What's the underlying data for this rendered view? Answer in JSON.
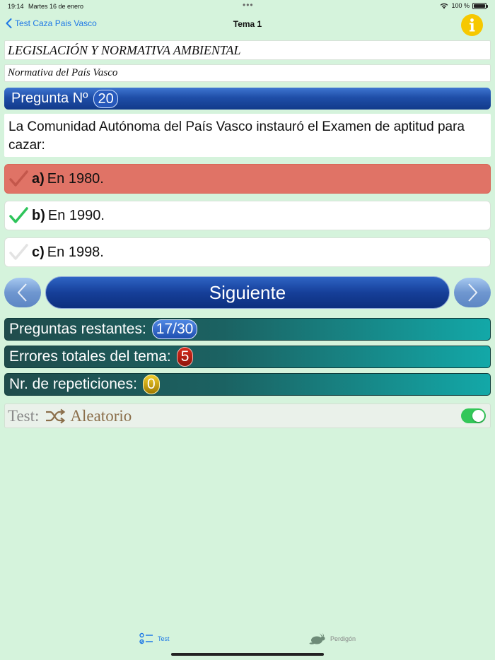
{
  "status_bar": {
    "time": "19:14",
    "date": "Martes 16 de enero",
    "battery": "100 %"
  },
  "nav": {
    "back_label": "Test Caza Pais Vasco",
    "title": "Tema 1"
  },
  "topic": "LEGISLACIÓN Y NORMATIVA AMBIENTAL",
  "subtopic": "Normativa del País Vasco",
  "question": {
    "label": "Pregunta Nº",
    "number": "20",
    "text": "La Comunidad Autónoma del País Vasco instauró el Examen de aptitud para cazar:"
  },
  "answers": [
    {
      "letter": "a)",
      "text": "En 1980.",
      "state": "wrong"
    },
    {
      "letter": "b)",
      "text": "En 1990.",
      "state": "correct"
    },
    {
      "letter": "c)",
      "text": "En 1998.",
      "state": "neutral"
    }
  ],
  "next_label": "Siguiente",
  "stats": {
    "remaining_label": "Preguntas restantes:",
    "remaining_value": "17/30",
    "errors_label": "Errores totales del tema:",
    "errors_value": "5",
    "repetitions_label": "Nr. de repeticiones:",
    "repetitions_value": "0"
  },
  "test_mode": {
    "label": "Test:",
    "mode": "Aleatorio",
    "enabled": true
  },
  "tabs": [
    {
      "label": "Test",
      "icon": "list-icon",
      "active": true
    },
    {
      "label": "Perdigón",
      "icon": "rabbit-icon",
      "active": false
    }
  ],
  "colors": {
    "background": "#d5f3dc",
    "accent": "#1e78e6",
    "wrong": "#e07366",
    "correct_check": "#2ec45a",
    "info": "#f6c800"
  }
}
